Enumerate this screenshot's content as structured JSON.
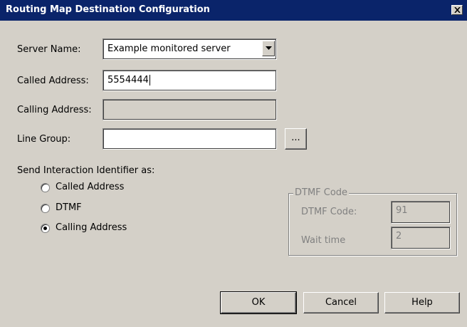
{
  "window": {
    "title": "Routing Map Destination Configuration",
    "close_icon": "close-icon"
  },
  "form": {
    "server_name": {
      "label": "Server Name:",
      "value": "Example monitored server"
    },
    "called_address": {
      "label": "Called Address:",
      "value": "5554444"
    },
    "calling_address": {
      "label": "Calling Address:",
      "value": ""
    },
    "line_group": {
      "label": "Line Group:",
      "value": "",
      "browse_label": "..."
    }
  },
  "send_identifier": {
    "label": "Send Interaction Identifier as:",
    "options": [
      {
        "label": "Called Address",
        "selected": false
      },
      {
        "label": "DTMF",
        "selected": false
      },
      {
        "label": "Calling Address",
        "selected": true
      }
    ]
  },
  "dtmf_group": {
    "legend": "DTMF Code",
    "code_label": "DTMF Code:",
    "code_value": "91",
    "wait_label": "Wait time",
    "wait_value": "2"
  },
  "buttons": {
    "ok": "OK",
    "cancel": "Cancel",
    "help": "Help"
  },
  "colors": {
    "titlebar": "#0a246a",
    "face": "#d4d0c8",
    "disabled_text": "#808080"
  }
}
